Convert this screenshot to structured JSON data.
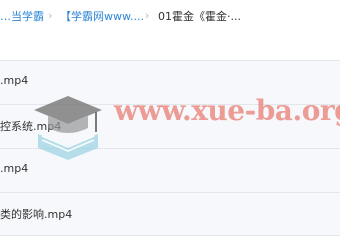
{
  "breadcrumb": {
    "item1": "当学霸",
    "item1_prefix": "…",
    "item2": "【学霸网www....",
    "item3": "01霍金《霍金·..."
  },
  "files": [
    {
      "name": ".mp4"
    },
    {
      "name": "控系统.mp4"
    },
    {
      "name": ".mp4"
    },
    {
      "name": "类的影响.mp4"
    }
  ],
  "watermark": {
    "text": "www.xue-ba.org",
    "icon": "graduation-cap-book-icon"
  },
  "colors": {
    "link": "#2f86d6",
    "row_bg": "#f6f8fb",
    "watermark": "#e8786e"
  }
}
